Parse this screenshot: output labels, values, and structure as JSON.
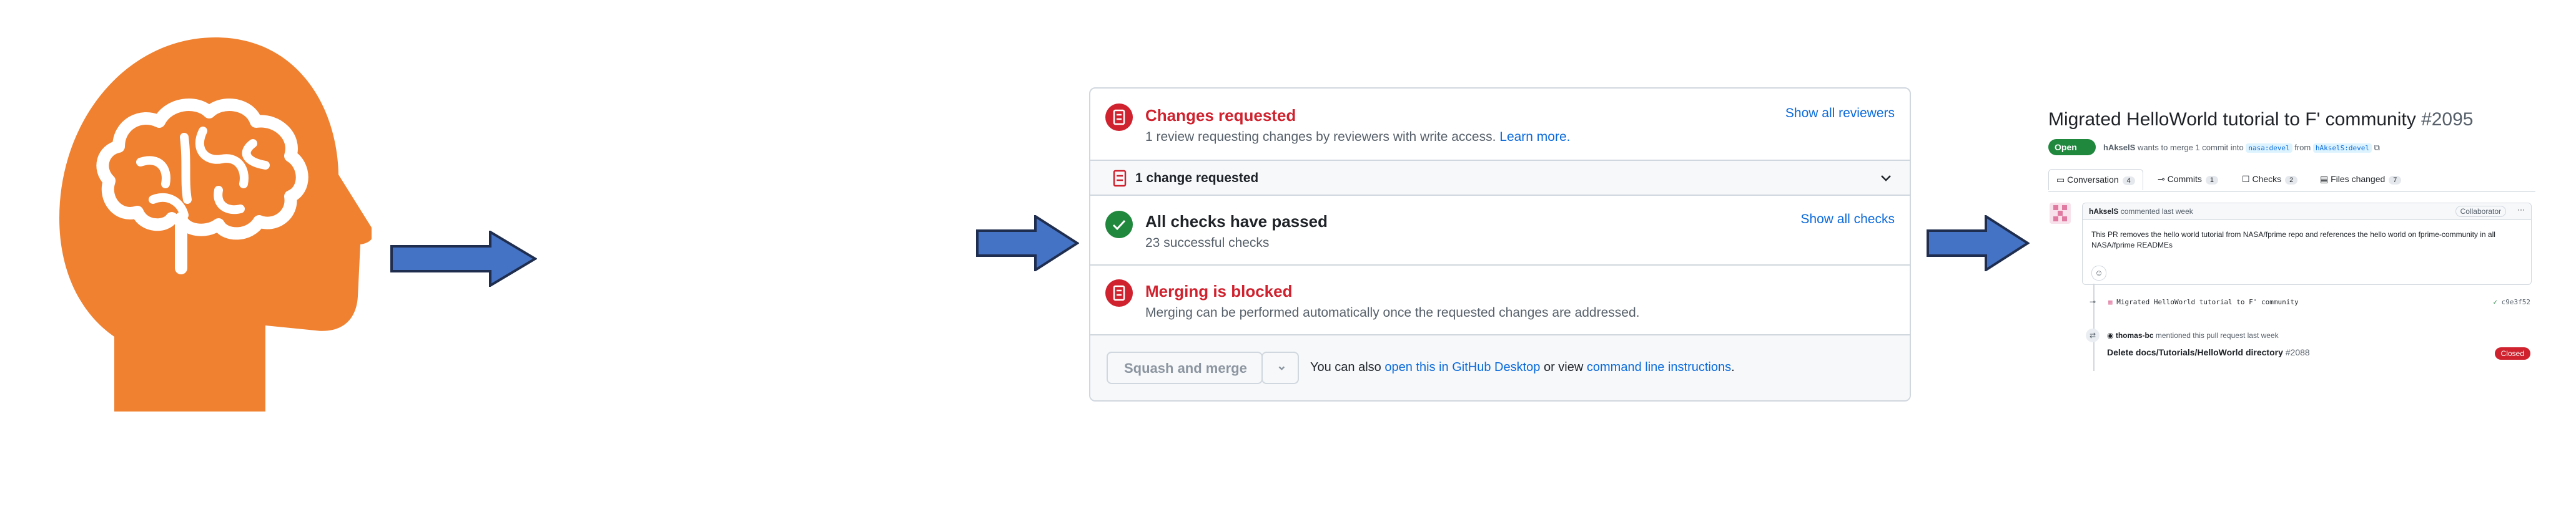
{
  "merge_panel": {
    "changes_requested": {
      "title": "Changes requested",
      "subtitle": "1 review requesting changes by reviewers with write access.",
      "learn_more": "Learn more.",
      "show_reviewers": "Show all reviewers"
    },
    "change_count": "1 change requested",
    "checks": {
      "title": "All checks have passed",
      "subtitle": "23 successful checks",
      "show_checks": "Show all checks"
    },
    "blocked": {
      "title": "Merging is blocked",
      "subtitle": "Merging can be performed automatically once the requested changes are addressed."
    },
    "footer": {
      "merge_button": "Squash and merge",
      "prefix": "You can also",
      "desktop_link": "open this in GitHub Desktop",
      "middle": "or view",
      "cli_link": "command line instructions",
      "suffix": "."
    }
  },
  "pr": {
    "title": "Migrated HelloWorld tutorial to F' community",
    "number": "#2095",
    "state": "Open",
    "meta": {
      "author": "hAkselS",
      "text1": "wants to merge 1 commit into",
      "base": "nasa:devel",
      "text2": "from",
      "head": "hAkselS:devel"
    },
    "tabs": [
      {
        "label": "Conversation",
        "count": "4"
      },
      {
        "label": "Commits",
        "count": "1"
      },
      {
        "label": "Checks",
        "count": "2"
      },
      {
        "label": "Files changed",
        "count": "7"
      }
    ],
    "comment": {
      "author": "hAkselS",
      "when": "commented last week",
      "role": "Collaborator",
      "body": "This PR removes the hello world tutorial from NASA/fprime repo and references the hello world on fprime-community in all NASA/fprime READMEs",
      "emoji": "☺"
    },
    "commit": {
      "message": "Migrated HelloWorld tutorial to F' community",
      "sha": "c9e3f52"
    },
    "mention": {
      "actor": "thomas-bc",
      "text": "mentioned this pull request last week",
      "linked_title": "Delete docs/Tutorials/HelloWorld directory",
      "linked_number": "#2088",
      "linked_state": "Closed"
    }
  },
  "colors": {
    "head_orange": "#ef8131",
    "arrow_blue": "#4472c4",
    "arrow_outline": "#1f2d4e",
    "danger": "#cf222e",
    "success": "#1f883d",
    "link": "#0969da"
  }
}
